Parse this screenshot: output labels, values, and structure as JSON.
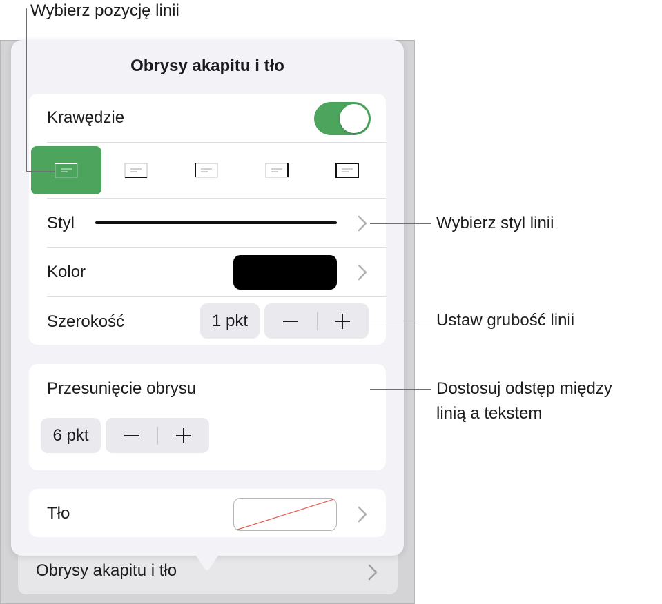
{
  "popover": {
    "title": "Obrysy akapitu i tło",
    "borders": {
      "label": "Krawędzie",
      "toggle_on": true,
      "positions": [
        {
          "name": "top",
          "selected": true
        },
        {
          "name": "bottom",
          "selected": false
        },
        {
          "name": "left",
          "selected": false
        },
        {
          "name": "right",
          "selected": false
        },
        {
          "name": "all",
          "selected": false
        }
      ]
    },
    "style": {
      "label": "Styl"
    },
    "color": {
      "label": "Kolor",
      "value": "#000000"
    },
    "width": {
      "label": "Szerokość",
      "value": "1 pkt",
      "minus": "−",
      "plus": "+"
    },
    "offset": {
      "label": "Przesunięcie obrysu",
      "value": "6 pkt",
      "minus": "−",
      "plus": "+"
    },
    "background": {
      "label": "Tło"
    }
  },
  "underlying": {
    "row_label": "Obrysy akapitu i tło"
  },
  "callouts": {
    "position": "Wybierz pozycję linii",
    "style": "Wybierz styl linii",
    "width": "Ustaw grubość linii",
    "offset_line1": "Dostosuj odstęp między",
    "offset_line2": "linią a tekstem"
  },
  "colors": {
    "accent_green": "#4ca45d",
    "card": "#ffffff",
    "popover_bg": "#f2f2f7"
  }
}
